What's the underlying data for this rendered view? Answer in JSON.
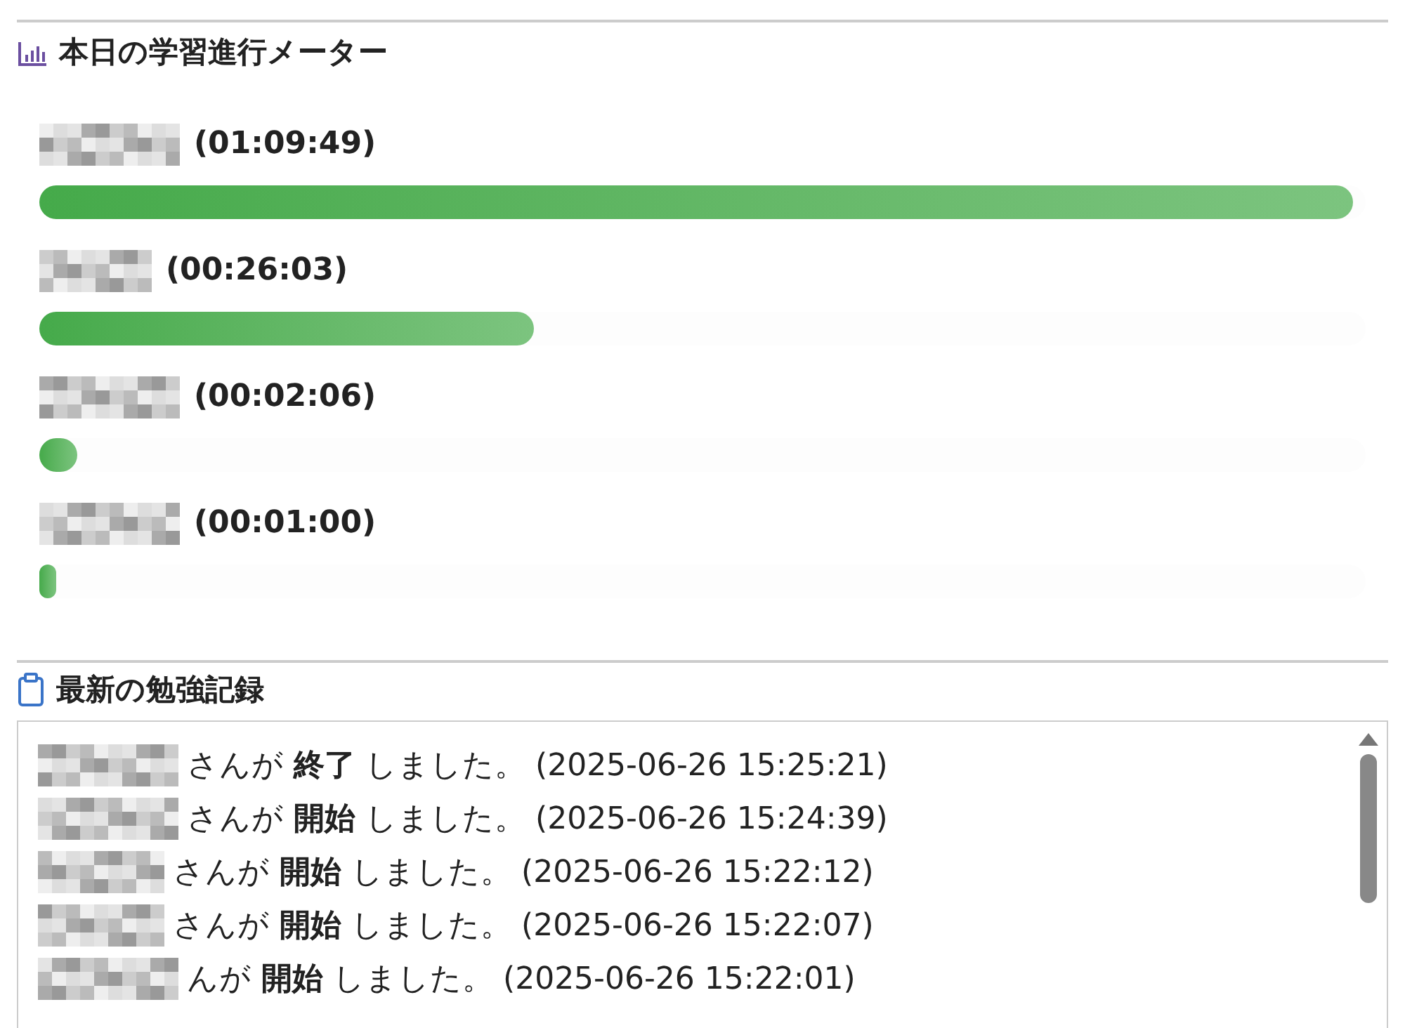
{
  "meter_section": {
    "title": "本日の学習進行メーター",
    "meters": [
      {
        "time": "(01:09:49)",
        "level": 0.99
      },
      {
        "time": "(00:26:03)",
        "level": 0.373
      },
      {
        "time": "(00:02:06)",
        "level": 0.029
      },
      {
        "time": "(00:01:00)",
        "level": 0.013
      }
    ]
  },
  "log_section": {
    "title": "最新の勉強記録",
    "entries": [
      {
        "text": "さんが **終了** しました。 (2025-06-26 15:25:21)"
      },
      {
        "text": "さんが **開始** しました。 (2025-06-26 15:24:39)"
      },
      {
        "text": "さんが **開始** しました。 (2025-06-26 15:22:12)"
      },
      {
        "text": "さんが **開始** しました。 (2025-06-26 15:22:07)"
      },
      {
        "text": "んが **開始** しました。 (2025-06-26 15:22:01)"
      }
    ]
  }
}
